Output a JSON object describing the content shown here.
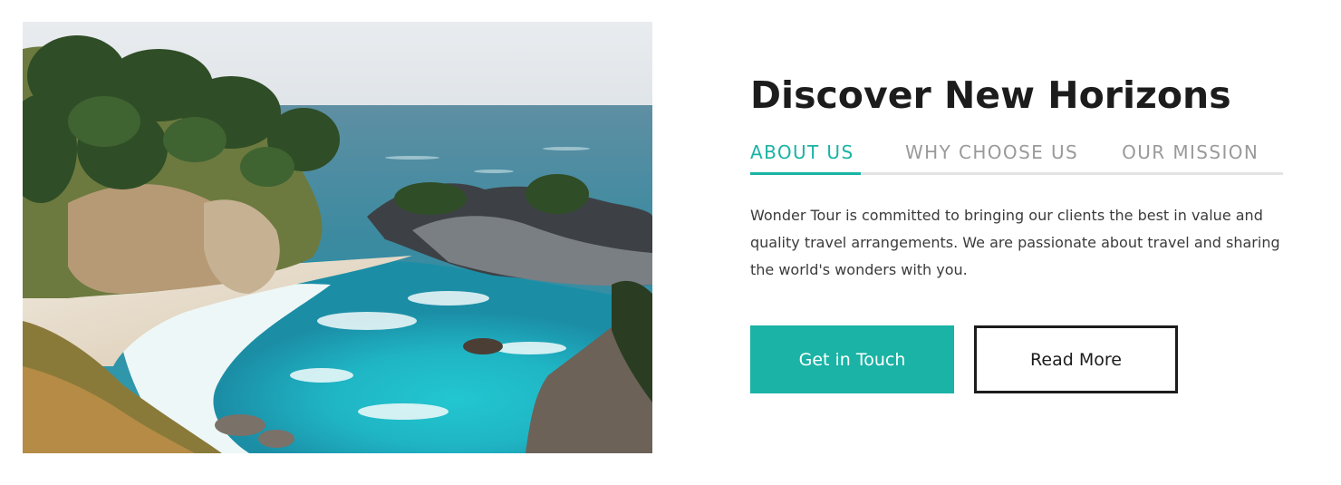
{
  "hero": {
    "image_alt": "Coastal cove with turquoise water, sandy beach and cypress-covered cliffs"
  },
  "content": {
    "title": "Discover New Horizons",
    "tabs": [
      {
        "label": "ABOUT US",
        "active": true
      },
      {
        "label": "WHY CHOOSE US",
        "active": false
      },
      {
        "label": "OUR MISSION",
        "active": false
      }
    ],
    "body": "Wonder Tour is committed to bringing our clients the best in value and quality travel arrangements. We are passionate about travel and sharing the world's wonders with you.",
    "buttons": {
      "primary_label": "Get in Touch",
      "secondary_label": "Read More"
    }
  },
  "colors": {
    "accent": "#1ab3a5",
    "title": "#1c1c1c",
    "tab_inactive": "#9a9a9a",
    "tab_rule": "#e3e3e3",
    "body_text": "#3b3b3b"
  }
}
